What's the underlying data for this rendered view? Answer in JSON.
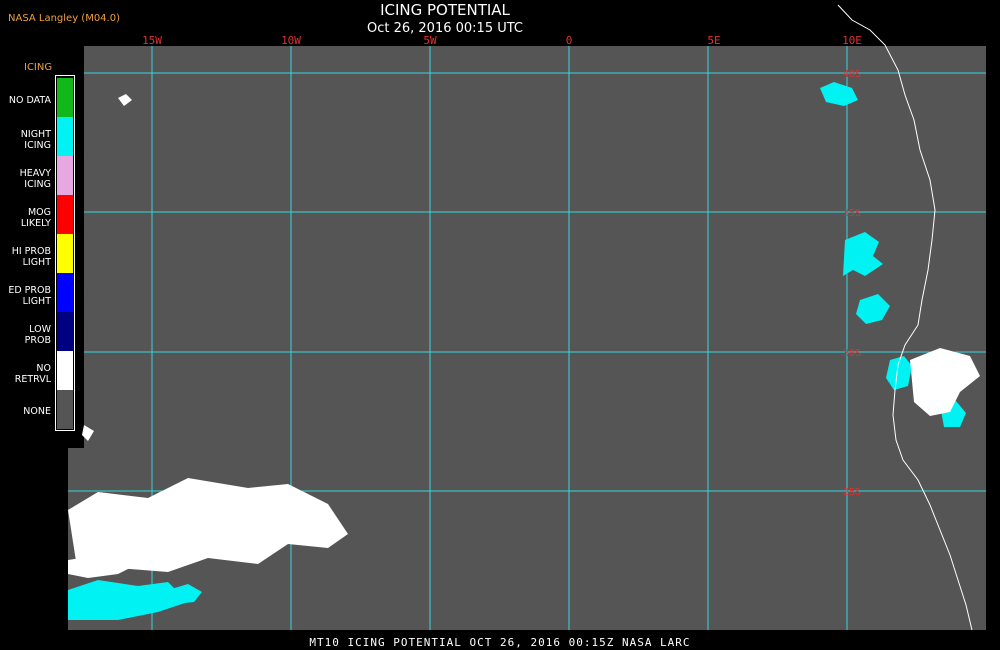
{
  "header": {
    "credit": "NASA Langley (M04.0)",
    "title": "ICING POTENTIAL",
    "subtitle": "Oct 26, 2016 00:15 UTC"
  },
  "map": {
    "background_color": "#555555",
    "grid_color": "#35d6e0",
    "coast_color": "#ffffff",
    "lon_labels": [
      "15W",
      "10W",
      "5W",
      "0",
      "5E",
      "10E"
    ],
    "lat_labels": [
      "40S",
      "35S",
      "30S",
      "25S"
    ]
  },
  "legend": {
    "title": "ICING",
    "items": [
      {
        "label_line1": "NO DATA",
        "label_line2": "",
        "color": "#12b81a"
      },
      {
        "label_line1": "NIGHT",
        "label_line2": "ICING",
        "color": "#00f2f2"
      },
      {
        "label_line1": "HEAVY",
        "label_line2": "ICING",
        "color": "#e6a8e0"
      },
      {
        "label_line1": "MOG",
        "label_line2": "LIKELY",
        "color": "#ff0000"
      },
      {
        "label_line1": "HI PROB",
        "label_line2": "LIGHT",
        "color": "#ffff00"
      },
      {
        "label_line1": "ED PROB",
        "label_line2": "LIGHT",
        "color": "#0000ff"
      },
      {
        "label_line1": "LOW",
        "label_line2": "PROB",
        "color": "#000080"
      },
      {
        "label_line1": "NO",
        "label_line2": "RETRVL",
        "color": "#ffffff"
      },
      {
        "label_line1": "NONE",
        "label_line2": "",
        "color": "#555555"
      }
    ]
  },
  "footer": {
    "text": "MT10  ICING POTENTIAL   OCT 26, 2016 00:15Z   NASA LARC"
  }
}
